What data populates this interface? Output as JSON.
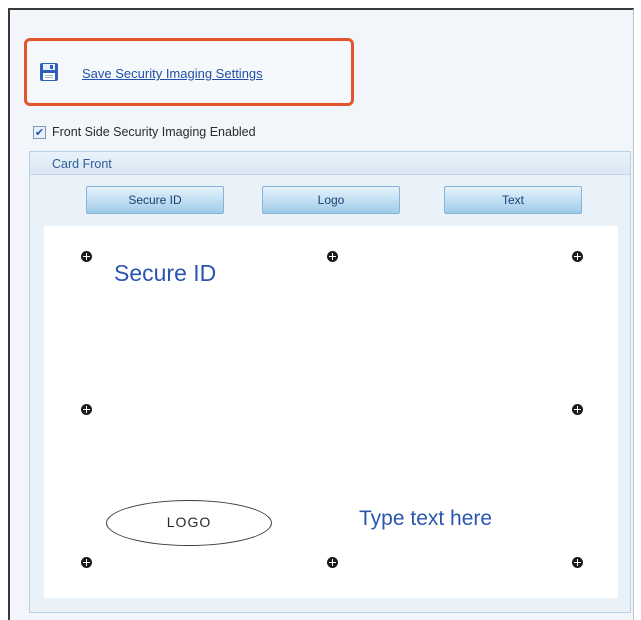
{
  "toolbar": {
    "save_label": "Save Security Imaging Settings",
    "save_icon": "floppy-disk-icon"
  },
  "front_side": {
    "enabled_label": "Front Side Security Imaging Enabled",
    "enabled": true
  },
  "card_front": {
    "title": "Card Front",
    "buttons": {
      "secure_id": "Secure ID",
      "logo": "Logo",
      "text": "Text"
    },
    "canvas": {
      "secure_id_text": "Secure ID",
      "logo_text": "LOGO",
      "text_placeholder": "Type text here"
    }
  },
  "colors": {
    "highlight_border": "#e2542a",
    "link": "#1f4fa8",
    "canvas_text": "#2b56b0"
  }
}
